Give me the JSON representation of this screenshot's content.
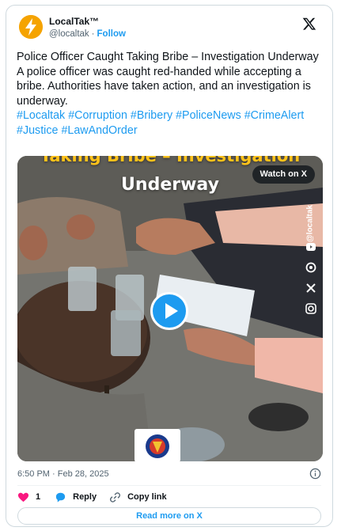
{
  "header": {
    "display_name": "LocalTak™",
    "handle": "@localtak",
    "separator": "·",
    "follow_label": "Follow",
    "avatar_icon": "lightning-bolt-icon",
    "platform_icon": "x-logo-icon"
  },
  "tweet": {
    "title": "Police Officer Caught Taking Bribe – Investigation Underway",
    "body": "A police officer was caught red-handed while accepting a bribe. Authorities have taken action, and an investigation is underway.",
    "hashtags": [
      "#Localtak",
      "#Corruption",
      "#Bribery",
      "#PoliceNews",
      "#CrimeAlert",
      "#Justice",
      "#LawAndOrder"
    ]
  },
  "media": {
    "overlay_top_partial": "Taking Bribe – Investigation",
    "overlay_main": "Underway",
    "watch_label": "Watch on X",
    "side_brand": "@localtak",
    "play_icon": "play-icon"
  },
  "footer": {
    "timestamp": "6:50 PM · Feb 28, 2025",
    "like_count": "1",
    "reply_label": "Reply",
    "copy_link_label": "Copy link",
    "read_more_label": "Read more on X"
  },
  "colors": {
    "accent": "#1d9bf0",
    "like": "#f91880",
    "text": "#0f1419",
    "muted": "#536471",
    "border": "#cfd9de"
  }
}
